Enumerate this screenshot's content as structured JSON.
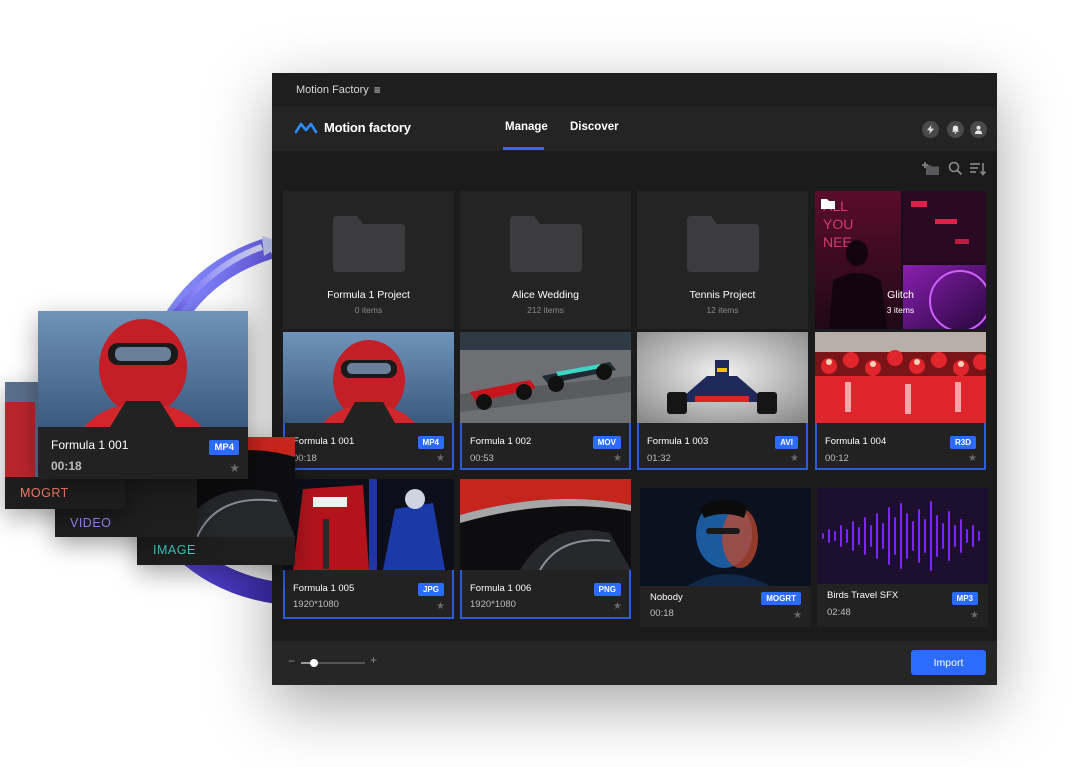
{
  "window": {
    "title": "Motion Factory",
    "brand": "Motion factory",
    "tabs": [
      {
        "label": "Manage",
        "active": true
      },
      {
        "label": "Discover",
        "active": false
      }
    ],
    "actions": [
      "lightning-icon",
      "bell-icon",
      "user-icon"
    ]
  },
  "toolbar": {
    "icons": [
      "add-folder-icon",
      "search-icon",
      "sort-icon"
    ]
  },
  "folders": [
    {
      "name": "Formula 1 Project",
      "count": "0 items"
    },
    {
      "name": "Alice Wedding",
      "count": "212  items"
    },
    {
      "name": "Tennis Project",
      "count": "12 items"
    },
    {
      "name": "Glitch",
      "count": "3 items"
    }
  ],
  "assets": [
    {
      "name": "Formula 1 001",
      "meta": "00:18",
      "format": "MP4",
      "selected": true
    },
    {
      "name": "Formula 1 002",
      "meta": "00:53",
      "format": "MOV",
      "selected": true
    },
    {
      "name": "Formula 1 003",
      "meta": "01:32",
      "format": "AVI",
      "selected": true
    },
    {
      "name": "Formula 1 004",
      "meta": "00:12",
      "format": "R3D",
      "selected": true
    },
    {
      "name": "Formula 1 005",
      "meta": "1920*1080",
      "format": "JPG",
      "selected": true
    },
    {
      "name": "Formula 1 006",
      "meta": "1920*1080",
      "format": "PNG",
      "selected": true
    },
    {
      "name": "Nobody",
      "meta": "00:18",
      "format": "MOGRT",
      "selected": false
    },
    {
      "name": "Birds Travel SFX",
      "meta": "02:48",
      "format": "MP3",
      "selected": false
    }
  ],
  "footer": {
    "zoom_minus": "−",
    "zoom_plus": "+",
    "zoom_level": 0.2,
    "import_label": "Import"
  },
  "drag_preview": {
    "name": "Formula 1 001",
    "duration": "00:18",
    "format": "MP4",
    "types": [
      {
        "label": "MOGRT",
        "color": "#ff7b6b"
      },
      {
        "label": "VIDEO",
        "color": "#9a8cff"
      },
      {
        "label": "IMAGE",
        "color": "#3fd6c8"
      }
    ]
  },
  "colors": {
    "accent": "#2b6bff",
    "background": "#1b1b1c"
  }
}
